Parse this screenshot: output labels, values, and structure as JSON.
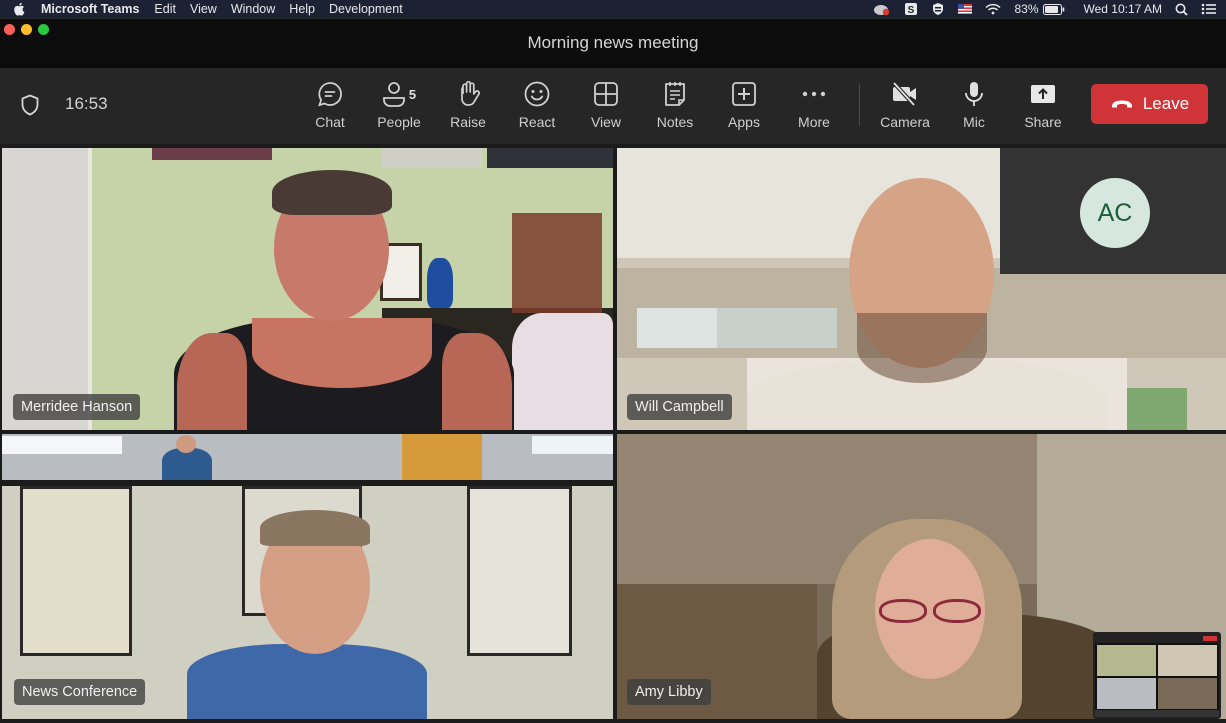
{
  "menubar": {
    "app_name": "Microsoft Teams",
    "menus": [
      "Edit",
      "View",
      "Window",
      "Help",
      "Development"
    ],
    "status_icons": [
      "creative-cloud-icon",
      "s-app-icon",
      "shield-app-icon",
      "us-flag-icon",
      "wifi-icon"
    ],
    "battery": "83%",
    "clock": "Wed 10:17 AM"
  },
  "window": {
    "title": "Morning news meeting"
  },
  "toolbar": {
    "timer": "16:53",
    "buttons": [
      {
        "id": "chat",
        "label": "Chat",
        "icon": "chat-icon"
      },
      {
        "id": "people",
        "label": "People",
        "icon": "people-icon",
        "badge": "5"
      },
      {
        "id": "raise",
        "label": "Raise",
        "icon": "hand-icon"
      },
      {
        "id": "react",
        "label": "React",
        "icon": "smiley-icon"
      },
      {
        "id": "view",
        "label": "View",
        "icon": "grid-icon"
      },
      {
        "id": "notes",
        "label": "Notes",
        "icon": "notes-icon"
      },
      {
        "id": "apps",
        "label": "Apps",
        "icon": "plus-square-icon"
      },
      {
        "id": "more",
        "label": "More",
        "icon": "ellipsis-icon"
      },
      {
        "id": "camera",
        "label": "Camera",
        "icon": "camera-off-icon"
      },
      {
        "id": "mic",
        "label": "Mic",
        "icon": "microphone-icon"
      },
      {
        "id": "share",
        "label": "Share",
        "icon": "share-screen-icon"
      }
    ],
    "leave_label": "Leave",
    "leave_color": "#d13438"
  },
  "participants": [
    {
      "name": "Merridee Hanson"
    },
    {
      "name": "Will Campbell"
    },
    {
      "name": "News Conference"
    },
    {
      "name": "Amy Libby"
    }
  ],
  "self_view": {
    "initials": "AC",
    "avatar_bg": "#d6e7df",
    "avatar_fg": "#1e5e3a"
  }
}
